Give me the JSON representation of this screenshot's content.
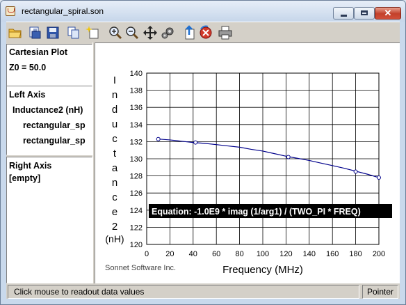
{
  "window": {
    "title": "rectangular_spiral.son",
    "buttons": {
      "minimize": "minimize",
      "maximize": "maximize",
      "close": "✕"
    }
  },
  "toolbar": {
    "icons": [
      "open-folder-icon",
      "save-as-icon",
      "save-icon",
      "copy-icon",
      "new-plot-icon",
      "zoom-in-icon",
      "zoom-out-icon",
      "pan-icon",
      "settings-icon",
      "export-icon",
      "stop-icon",
      "print-icon"
    ]
  },
  "sidebar": {
    "plot_section": {
      "heading": "Cartesian Plot",
      "z0": "Z0 = 50.0"
    },
    "left_axis": {
      "heading": "Left Axis",
      "measurement": "Inductance2 (nH)",
      "files": [
        "rectangular_sp",
        "rectangular_sp"
      ]
    },
    "right_axis": {
      "heading": "Right Axis",
      "value": "[empty]"
    }
  },
  "chart_data": {
    "type": "line",
    "xlabel": "Frequency (MHz)",
    "ylabel": "Inductance2",
    "yunit": "(nH)",
    "xlim": [
      0,
      200
    ],
    "ylim": [
      120,
      140
    ],
    "xticks": [
      "0",
      "20",
      "40",
      "60",
      "80",
      "100",
      "120",
      "140",
      "160",
      "180",
      "200"
    ],
    "yticks": [
      "120",
      "122",
      "124",
      "126",
      "128",
      "130",
      "132",
      "134",
      "136",
      "138",
      "140"
    ],
    "grid": true,
    "series": [
      {
        "color": "#00008b",
        "x": [
          10,
          20,
          30,
          40,
          50,
          60,
          70,
          80,
          90,
          100,
          110,
          120,
          130,
          140,
          150,
          160,
          170,
          180,
          190,
          200
        ],
        "values": [
          132.3,
          132.2,
          132.05,
          131.9,
          131.8,
          131.65,
          131.5,
          131.35,
          131.1,
          130.9,
          130.6,
          130.3,
          130.05,
          129.8,
          129.5,
          129.2,
          128.9,
          128.55,
          128.2,
          127.8
        ]
      }
    ],
    "markers": {
      "x": [
        10,
        42,
        122,
        180,
        200
      ],
      "values": [
        132.3,
        131.9,
        130.2,
        128.5,
        127.8
      ]
    },
    "equation": "Equation: -1.0E9 * imag (1/arg1) / (TWO_PI * FREQ)",
    "credit": "Sonnet Software Inc."
  },
  "status": {
    "message": "Click mouse to readout data values",
    "mode": "Pointer"
  }
}
